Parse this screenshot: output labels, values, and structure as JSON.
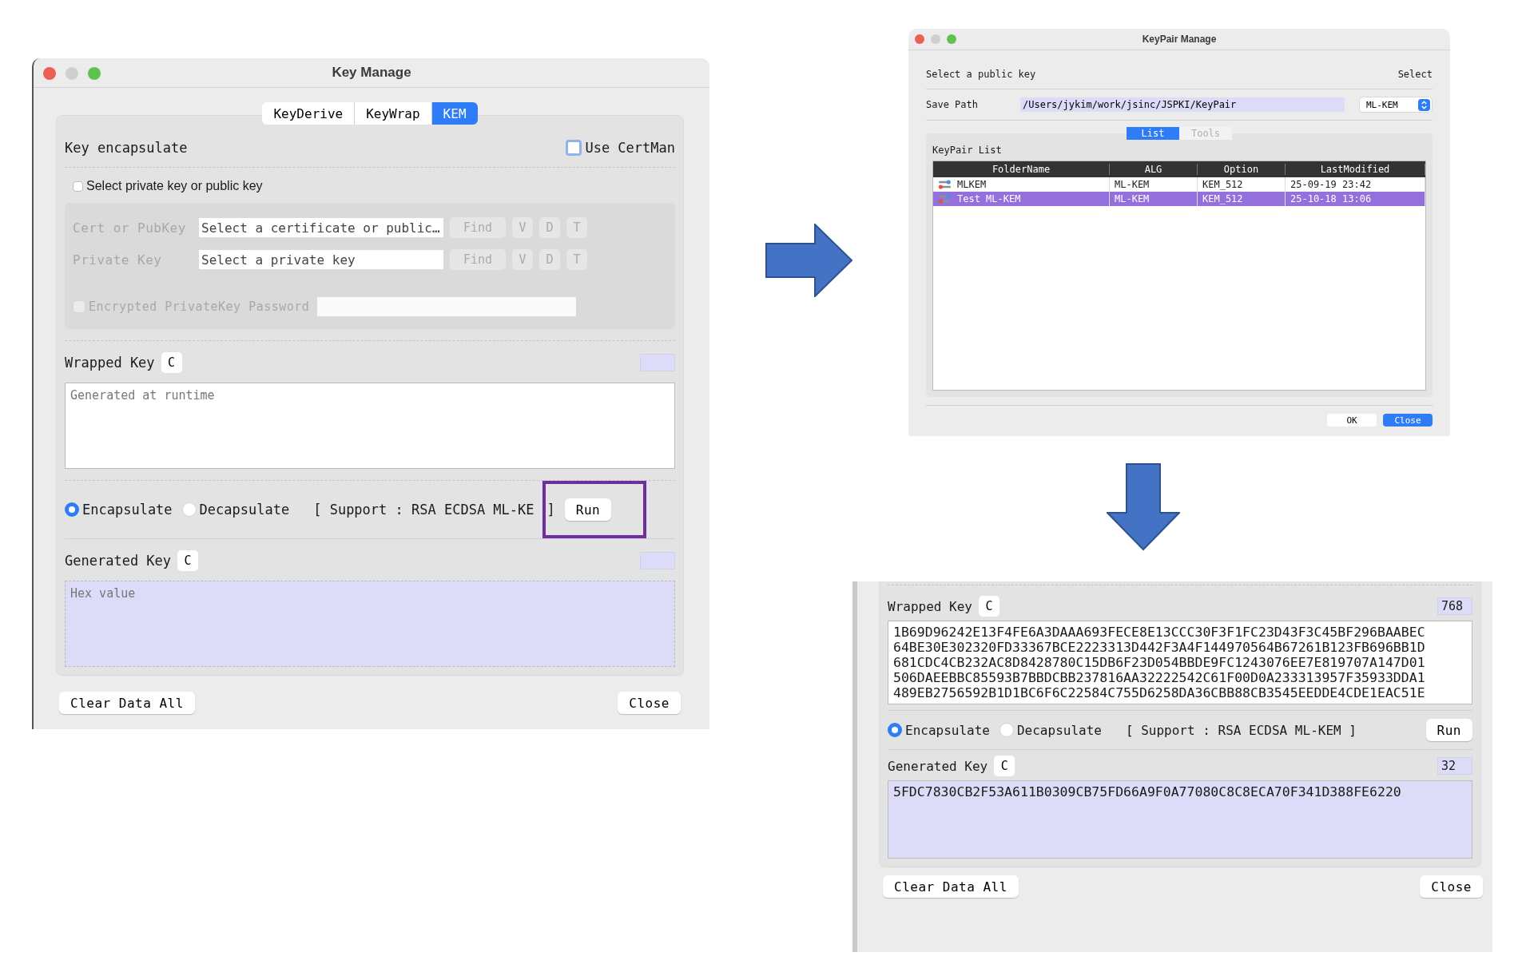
{
  "key_manage": {
    "title": "Key Manage",
    "tabs": [
      {
        "label": "KeyDerive",
        "selected": false
      },
      {
        "label": "KeyWrap",
        "selected": false
      },
      {
        "label": "KEM",
        "selected": true
      }
    ],
    "heading": "Key encapsulate",
    "use_certman": {
      "label": "Use CertMan",
      "checked": false
    },
    "select_key": {
      "label": "Select private key or public key",
      "checked": false
    },
    "key_inputs": {
      "disabled": true,
      "rows": [
        {
          "label": "Cert or PubKey",
          "placeholder": "Select a certificate or public…",
          "buttons": [
            "Find",
            "V",
            "D",
            "T"
          ]
        },
        {
          "label": "Private Key",
          "placeholder": "Select a private key",
          "buttons": [
            "Find",
            "V",
            "D",
            "T"
          ]
        }
      ],
      "password": {
        "label": "Encrypted PrivateKey Password",
        "checked": false
      }
    },
    "wrapped_key": {
      "label": "Wrapped Key",
      "clear": "C",
      "placeholder": "Generated at runtime"
    },
    "modes": [
      {
        "label": "Encapsulate",
        "selected": true
      },
      {
        "label": "Decapsulate",
        "selected": false
      }
    ],
    "support": "[ Support : RSA ECDSA ML-KE",
    "support_end": "]",
    "run": "Run",
    "generated_key": {
      "label": "Generated Key",
      "clear": "C",
      "placeholder": "Hex value"
    },
    "buttons": [
      "Clear Data All",
      "Close"
    ]
  },
  "keypair_manage": {
    "title": "KeyPair Manage",
    "heading": "Select a public key",
    "heading_right": "Select",
    "save_path": {
      "label": "Save Path",
      "value": "/Users/jykim/work/jsinc/JSPKI/KeyPair",
      "algorithm": "ML-KEM"
    },
    "tabs": [
      {
        "label": "List",
        "selected": true
      },
      {
        "label": "Tools",
        "selected": false
      }
    ],
    "list_title": "KeyPair List",
    "columns": [
      "FolderName",
      "ALG",
      "Option",
      "LastModified"
    ],
    "rows": [
      {
        "cells": [
          "MLKEM",
          "ML-KEM",
          "KEM_512",
          "25-09-19 23:42"
        ],
        "selected": false
      },
      {
        "cells": [
          "Test ML-KEM",
          "ML-KEM",
          "KEM_512",
          "25-10-18 13:06"
        ],
        "selected": true
      }
    ],
    "buttons": [
      {
        "label": "OK",
        "default": false
      },
      {
        "label": "Close",
        "default": true
      }
    ]
  },
  "result": {
    "wrapped_key": {
      "label": "Wrapped Key",
      "clear": "C",
      "length": "768",
      "lines": [
        "1B69D96242E13F4FE6A3DAAA693FECE8E13CCC30F3F1FC23D43F3C45BF296BAABEC",
        "64BE30E302320FD33367BCE2223313D442F3A4F144970564B67261B123FB696BB1D",
        "681CDC4CB232AC8D8428780C15DB6F23D054BBDE9FC1243076EE7E819707A147D01",
        "506DAEEBBC85593B7BBDCBB237816AA32222542C61F00D0A233313957F35933DDA1",
        "489EB2756592B1D1BC6F6C22584C755D6258DA36CBB88CB3545EEDDE4CDE1EAC51E"
      ]
    },
    "modes": [
      {
        "label": "Encapsulate",
        "selected": true
      },
      {
        "label": "Decapsulate",
        "selected": false
      }
    ],
    "support": "[ Support : RSA ECDSA ML-KEM ]",
    "run": "Run",
    "generated_key": {
      "label": "Generated Key",
      "clear": "C",
      "length": "32",
      "value": "5FDC7830CB2F53A611B0309CB75FD66A9F0A77080C8C8ECA70F341D388FE6220"
    },
    "buttons": [
      "Clear Data All",
      "Close"
    ]
  }
}
